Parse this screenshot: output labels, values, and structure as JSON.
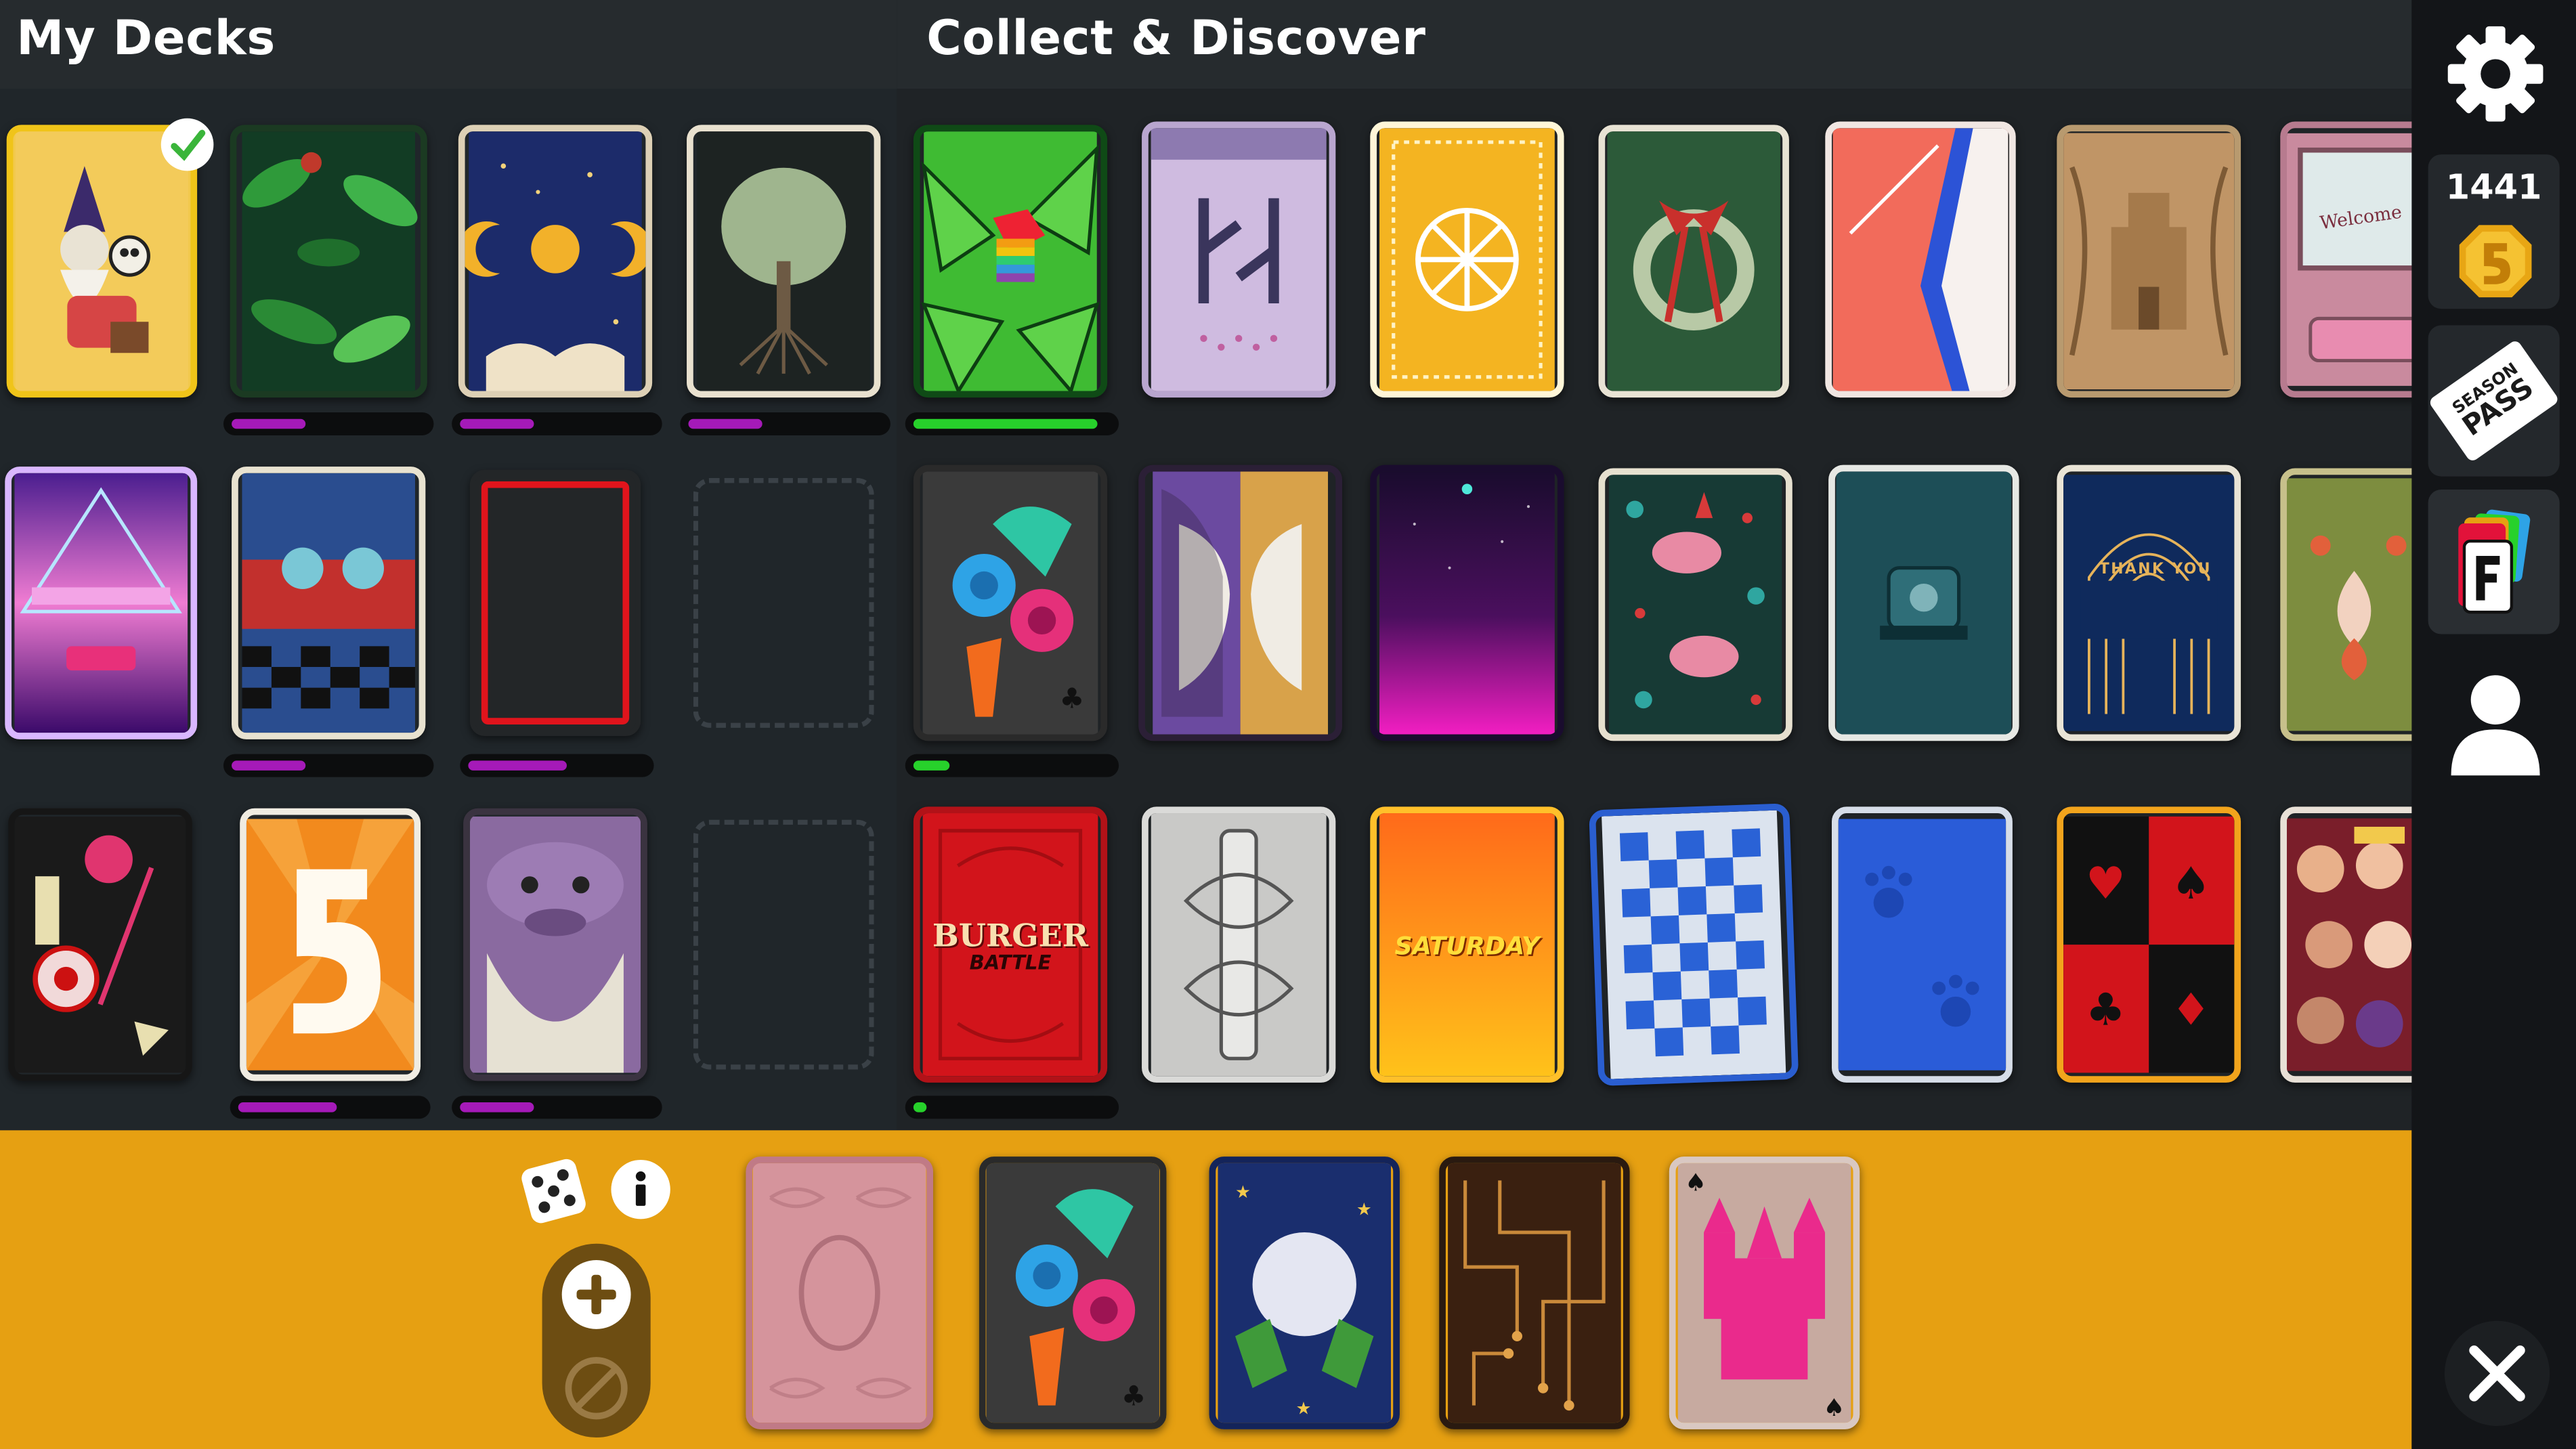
{
  "my_decks": {
    "title": "My Decks",
    "cards": [
      {
        "name": "wizard-skull-deck",
        "selected": true,
        "progress": 0
      },
      {
        "name": "jungle-deck",
        "progress": 0.38
      },
      {
        "name": "zodiac-moon-deck",
        "progress": 0.38
      },
      {
        "name": "willow-tree-deck",
        "progress": 0.38
      },
      {
        "name": "synthwave-deck",
        "progress": 0
      },
      {
        "name": "diner-dinos-deck",
        "progress": 0.38
      },
      {
        "name": "red-outline-deck",
        "progress": 0.55
      },
      {
        "name": "halloween-candy-deck",
        "progress": 0
      },
      {
        "name": "five-logo-deck",
        "progress": 0.43
      },
      {
        "name": "monster-beard-deck",
        "progress": 0.38
      }
    ]
  },
  "collect": {
    "title": "Collect & Discover",
    "cards": [
      {
        "name": "rainbow-bird-leaves-deck",
        "progress": 0.93
      },
      {
        "name": "glyph-pattern-deck"
      },
      {
        "name": "sunburst-gold-deck"
      },
      {
        "name": "holiday-wreath-deck"
      },
      {
        "name": "coral-stripe-deck"
      },
      {
        "name": "sandcastle-deck"
      },
      {
        "name": "welcome-door-deck"
      },
      {
        "name": "roses-hand-deck",
        "progress": 0.2
      },
      {
        "name": "two-faces-deck"
      },
      {
        "name": "night-sky-deck"
      },
      {
        "name": "winter-birds-deck"
      },
      {
        "name": "teal-machine-deck"
      },
      {
        "name": "key-workers-deck"
      },
      {
        "name": "folk-flower-deck"
      },
      {
        "name": "burger-battle-deck",
        "progress": 0.06
      },
      {
        "name": "silver-engraved-deck"
      },
      {
        "name": "saturday-deck"
      },
      {
        "name": "blue-checker-deck"
      },
      {
        "name": "paw-print-deck"
      },
      {
        "name": "pixel-suits-deck"
      },
      {
        "name": "drag-queens-deck"
      }
    ],
    "burger_text": "BURGER",
    "battle_text": "BATTLE",
    "saturday_text": "SATURDAY",
    "welcome_text": "Welcome",
    "thank_you_text": "THANK YOU"
  },
  "sidebar": {
    "coins": "1441",
    "season_pass_line1": "SEASON",
    "season_pass_line2": "PASS"
  },
  "tray": {
    "cards": [
      "pink-damask-deck",
      "roses-hand-deck",
      "snowball-stars-deck",
      "circuit-board-deck",
      "pink-castle-deck"
    ]
  },
  "colors": {
    "accent_gold": "#e6a012",
    "progress_purple": "#a51ab8",
    "progress_green": "#27d12b"
  }
}
